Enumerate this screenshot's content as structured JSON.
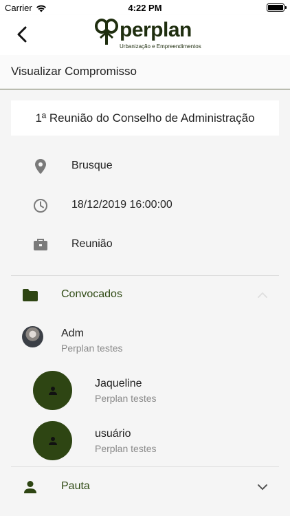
{
  "status_bar": {
    "carrier": "Carrier",
    "time": "4:22 PM"
  },
  "nav": {
    "brand_name": "perplan",
    "brand_tagline": "Urbanização e Empreendimentos"
  },
  "page": {
    "title": "Visualizar Compromisso"
  },
  "event": {
    "title": "1ª Reunião do Conselho de Administração",
    "location": "Brusque",
    "datetime": "18/12/2019 16:00:00",
    "type": "Reunião"
  },
  "sections": {
    "convocados_label": "Convocados",
    "pauta_label": "Pauta"
  },
  "convocados": [
    {
      "name": "Adm",
      "org": "Perplan testes"
    },
    {
      "name": "Jaqueline",
      "org": "Perplan testes"
    },
    {
      "name": "usuário",
      "org": "Perplan testes"
    }
  ],
  "colors": {
    "accent": "#2f4a14",
    "avatar_bg": "#2e4513",
    "divider": "#666a4f"
  },
  "icons": [
    "back-chevron-icon",
    "logo-tree-icon",
    "location-pin-icon",
    "clock-icon",
    "briefcase-icon",
    "folder-icon",
    "chevron-up-icon",
    "person-icon",
    "chevron-down-icon",
    "wifi-icon",
    "battery-icon"
  ]
}
